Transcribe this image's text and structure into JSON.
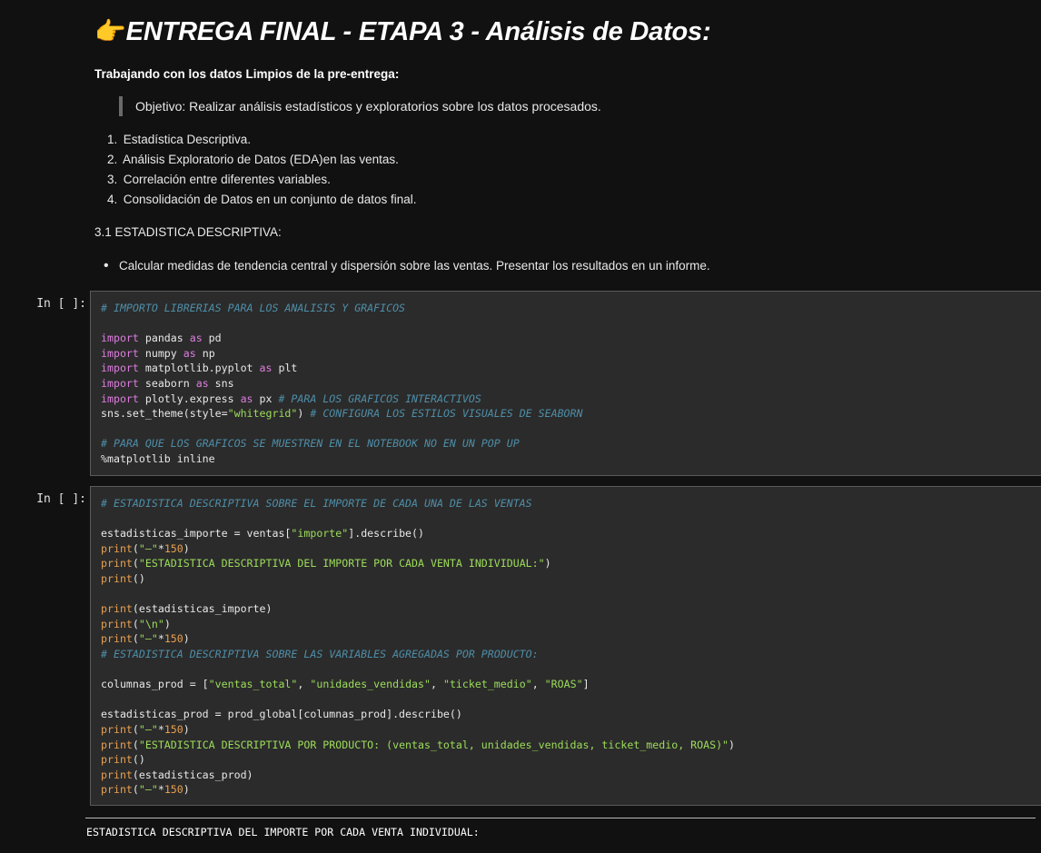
{
  "markdown": {
    "title_icon": "👉",
    "title": "ENTREGA FINAL - ETAPA 3 - Análisis de Datos:",
    "subtitle": "Trabajando con los datos Limpios de la pre-entrega:",
    "quote": "Objetivo: Realizar análisis estadísticos y exploratorios sobre los datos procesados.",
    "list": [
      {
        "num": "1.",
        "text": "Estadística Descriptiva."
      },
      {
        "num": "2.",
        "text": "Análisis Exploratorio de Datos (EDA)en las ventas."
      },
      {
        "num": "3.",
        "text": "Correlación entre diferentes variables."
      },
      {
        "num": "4.",
        "text": "Consolidación de Datos en un conjunto de datos final."
      }
    ],
    "section": "3.1 ESTADISTICA DESCRIPTIVA:",
    "bullet": "Calcular medidas de tendencia central y dispersión sobre las ventas. Presentar los resultados en un informe."
  },
  "cells": [
    {
      "prompt": "In [ ]:",
      "lines": [
        [
          {
            "t": "cm",
            "v": "# IMPORTO LIBRERIAS PARA LOS ANALISIS Y GRAFICOS"
          }
        ],
        [],
        [
          {
            "t": "kw",
            "v": "import"
          },
          {
            "t": "",
            "v": " pandas "
          },
          {
            "t": "kw",
            "v": "as"
          },
          {
            "t": "",
            "v": " pd"
          }
        ],
        [
          {
            "t": "kw",
            "v": "import"
          },
          {
            "t": "",
            "v": " numpy "
          },
          {
            "t": "kw",
            "v": "as"
          },
          {
            "t": "",
            "v": " np"
          }
        ],
        [
          {
            "t": "kw",
            "v": "import"
          },
          {
            "t": "",
            "v": " matplotlib.pyplot "
          },
          {
            "t": "kw",
            "v": "as"
          },
          {
            "t": "",
            "v": " plt"
          }
        ],
        [
          {
            "t": "kw",
            "v": "import"
          },
          {
            "t": "",
            "v": " seaborn "
          },
          {
            "t": "kw",
            "v": "as"
          },
          {
            "t": "",
            "v": " sns"
          }
        ],
        [
          {
            "t": "kw",
            "v": "import"
          },
          {
            "t": "",
            "v": " plotly.express "
          },
          {
            "t": "kw",
            "v": "as"
          },
          {
            "t": "",
            "v": " px "
          },
          {
            "t": "cm",
            "v": "# PARA LOS GRAFICOS INTERACTIVOS"
          }
        ],
        [
          {
            "t": "",
            "v": "sns.set_theme(style="
          },
          {
            "t": "st",
            "v": "\"whitegrid\""
          },
          {
            "t": "",
            "v": ") "
          },
          {
            "t": "cm",
            "v": "# CONFIGURA LOS ESTILOS VISUALES DE SEABORN"
          }
        ],
        [],
        [
          {
            "t": "cm",
            "v": "# PARA QUE LOS GRAFICOS SE MUESTREN EN EL NOTEBOOK NO EN UN POP UP"
          }
        ],
        [
          {
            "t": "",
            "v": "%matplotlib inline"
          }
        ]
      ]
    },
    {
      "prompt": "In [ ]:",
      "lines": [
        [
          {
            "t": "cm",
            "v": "# ESTADISTICA DESCRIPTIVA SOBRE EL IMPORTE DE CADA UNA DE LAS VENTAS"
          }
        ],
        [],
        [
          {
            "t": "",
            "v": "estadisticas_importe = ventas["
          },
          {
            "t": "st",
            "v": "\"importe\""
          },
          {
            "t": "",
            "v": "].describe()"
          }
        ],
        [
          {
            "t": "fn",
            "v": "print"
          },
          {
            "t": "",
            "v": "("
          },
          {
            "t": "st",
            "v": "\"—\""
          },
          {
            "t": "",
            "v": "*"
          },
          {
            "t": "nm",
            "v": "150"
          },
          {
            "t": "",
            "v": ")"
          }
        ],
        [
          {
            "t": "fn",
            "v": "print"
          },
          {
            "t": "",
            "v": "("
          },
          {
            "t": "st",
            "v": "\"ESTADISTICA DESCRIPTIVA DEL IMPORTE POR CADA VENTA INDIVIDUAL:\""
          },
          {
            "t": "",
            "v": ")"
          }
        ],
        [
          {
            "t": "fn",
            "v": "print"
          },
          {
            "t": "",
            "v": "()"
          }
        ],
        [],
        [
          {
            "t": "fn",
            "v": "print"
          },
          {
            "t": "",
            "v": "(estadisticas_importe)"
          }
        ],
        [
          {
            "t": "fn",
            "v": "print"
          },
          {
            "t": "",
            "v": "("
          },
          {
            "t": "st",
            "v": "\"\\n\""
          },
          {
            "t": "",
            "v": ")"
          }
        ],
        [
          {
            "t": "fn",
            "v": "print"
          },
          {
            "t": "",
            "v": "("
          },
          {
            "t": "st",
            "v": "\"—\""
          },
          {
            "t": "",
            "v": "*"
          },
          {
            "t": "nm",
            "v": "150"
          },
          {
            "t": "",
            "v": ")"
          }
        ],
        [
          {
            "t": "cm",
            "v": "# ESTADISTICA DESCRIPTIVA SOBRE LAS VARIABLES AGREGADAS POR PRODUCTO:"
          }
        ],
        [],
        [
          {
            "t": "",
            "v": "columnas_prod = ["
          },
          {
            "t": "st",
            "v": "\"ventas_total\""
          },
          {
            "t": "",
            "v": ", "
          },
          {
            "t": "st",
            "v": "\"unidades_vendidas\""
          },
          {
            "t": "",
            "v": ", "
          },
          {
            "t": "st",
            "v": "\"ticket_medio\""
          },
          {
            "t": "",
            "v": ", "
          },
          {
            "t": "st",
            "v": "\"ROAS\""
          },
          {
            "t": "",
            "v": "]"
          }
        ],
        [],
        [
          {
            "t": "",
            "v": "estadisticas_prod = prod_global[columnas_prod].describe()"
          }
        ],
        [
          {
            "t": "fn",
            "v": "print"
          },
          {
            "t": "",
            "v": "("
          },
          {
            "t": "st",
            "v": "\"—\""
          },
          {
            "t": "",
            "v": "*"
          },
          {
            "t": "nm",
            "v": "150"
          },
          {
            "t": "",
            "v": ")"
          }
        ],
        [
          {
            "t": "fn",
            "v": "print"
          },
          {
            "t": "",
            "v": "("
          },
          {
            "t": "st",
            "v": "\"ESTADISTICA DESCRIPTIVA POR PRODUCTO: (ventas_total, unidades_vendidas, ticket_medio, ROAS)\""
          },
          {
            "t": "",
            "v": ")"
          }
        ],
        [
          {
            "t": "fn",
            "v": "print"
          },
          {
            "t": "",
            "v": "()"
          }
        ],
        [
          {
            "t": "fn",
            "v": "print"
          },
          {
            "t": "",
            "v": "(estadisticas_prod)"
          }
        ],
        [
          {
            "t": "fn",
            "v": "print"
          },
          {
            "t": "",
            "v": "("
          },
          {
            "t": "st",
            "v": "\"—\""
          },
          {
            "t": "",
            "v": "*"
          },
          {
            "t": "nm",
            "v": "150"
          },
          {
            "t": "",
            "v": ")"
          }
        ]
      ]
    }
  ],
  "output": {
    "text": "ESTADISTICA DESCRIPTIVA DEL IMPORTE POR CADA VENTA INDIVIDUAL:"
  }
}
